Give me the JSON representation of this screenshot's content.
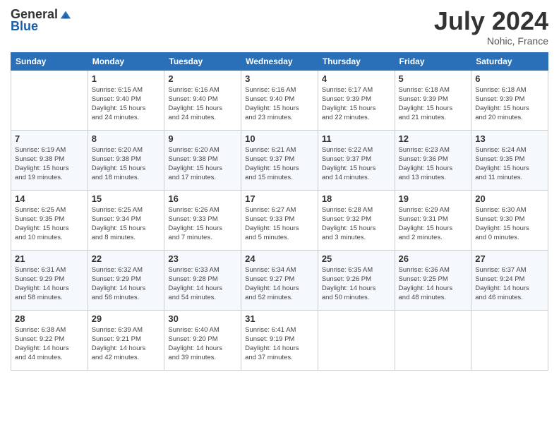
{
  "header": {
    "logo_general": "General",
    "logo_blue": "Blue",
    "month_title": "July 2024",
    "location": "Nohic, France"
  },
  "days_of_week": [
    "Sunday",
    "Monday",
    "Tuesday",
    "Wednesday",
    "Thursday",
    "Friday",
    "Saturday"
  ],
  "weeks": [
    [
      {
        "day": "",
        "info": ""
      },
      {
        "day": "1",
        "info": "Sunrise: 6:15 AM\nSunset: 9:40 PM\nDaylight: 15 hours\nand 24 minutes."
      },
      {
        "day": "2",
        "info": "Sunrise: 6:16 AM\nSunset: 9:40 PM\nDaylight: 15 hours\nand 24 minutes."
      },
      {
        "day": "3",
        "info": "Sunrise: 6:16 AM\nSunset: 9:40 PM\nDaylight: 15 hours\nand 23 minutes."
      },
      {
        "day": "4",
        "info": "Sunrise: 6:17 AM\nSunset: 9:39 PM\nDaylight: 15 hours\nand 22 minutes."
      },
      {
        "day": "5",
        "info": "Sunrise: 6:18 AM\nSunset: 9:39 PM\nDaylight: 15 hours\nand 21 minutes."
      },
      {
        "day": "6",
        "info": "Sunrise: 6:18 AM\nSunset: 9:39 PM\nDaylight: 15 hours\nand 20 minutes."
      }
    ],
    [
      {
        "day": "7",
        "info": "Sunrise: 6:19 AM\nSunset: 9:38 PM\nDaylight: 15 hours\nand 19 minutes."
      },
      {
        "day": "8",
        "info": "Sunrise: 6:20 AM\nSunset: 9:38 PM\nDaylight: 15 hours\nand 18 minutes."
      },
      {
        "day": "9",
        "info": "Sunrise: 6:20 AM\nSunset: 9:38 PM\nDaylight: 15 hours\nand 17 minutes."
      },
      {
        "day": "10",
        "info": "Sunrise: 6:21 AM\nSunset: 9:37 PM\nDaylight: 15 hours\nand 15 minutes."
      },
      {
        "day": "11",
        "info": "Sunrise: 6:22 AM\nSunset: 9:37 PM\nDaylight: 15 hours\nand 14 minutes."
      },
      {
        "day": "12",
        "info": "Sunrise: 6:23 AM\nSunset: 9:36 PM\nDaylight: 15 hours\nand 13 minutes."
      },
      {
        "day": "13",
        "info": "Sunrise: 6:24 AM\nSunset: 9:35 PM\nDaylight: 15 hours\nand 11 minutes."
      }
    ],
    [
      {
        "day": "14",
        "info": "Sunrise: 6:25 AM\nSunset: 9:35 PM\nDaylight: 15 hours\nand 10 minutes."
      },
      {
        "day": "15",
        "info": "Sunrise: 6:25 AM\nSunset: 9:34 PM\nDaylight: 15 hours\nand 8 minutes."
      },
      {
        "day": "16",
        "info": "Sunrise: 6:26 AM\nSunset: 9:33 PM\nDaylight: 15 hours\nand 7 minutes."
      },
      {
        "day": "17",
        "info": "Sunrise: 6:27 AM\nSunset: 9:33 PM\nDaylight: 15 hours\nand 5 minutes."
      },
      {
        "day": "18",
        "info": "Sunrise: 6:28 AM\nSunset: 9:32 PM\nDaylight: 15 hours\nand 3 minutes."
      },
      {
        "day": "19",
        "info": "Sunrise: 6:29 AM\nSunset: 9:31 PM\nDaylight: 15 hours\nand 2 minutes."
      },
      {
        "day": "20",
        "info": "Sunrise: 6:30 AM\nSunset: 9:30 PM\nDaylight: 15 hours\nand 0 minutes."
      }
    ],
    [
      {
        "day": "21",
        "info": "Sunrise: 6:31 AM\nSunset: 9:29 PM\nDaylight: 14 hours\nand 58 minutes."
      },
      {
        "day": "22",
        "info": "Sunrise: 6:32 AM\nSunset: 9:29 PM\nDaylight: 14 hours\nand 56 minutes."
      },
      {
        "day": "23",
        "info": "Sunrise: 6:33 AM\nSunset: 9:28 PM\nDaylight: 14 hours\nand 54 minutes."
      },
      {
        "day": "24",
        "info": "Sunrise: 6:34 AM\nSunset: 9:27 PM\nDaylight: 14 hours\nand 52 minutes."
      },
      {
        "day": "25",
        "info": "Sunrise: 6:35 AM\nSunset: 9:26 PM\nDaylight: 14 hours\nand 50 minutes."
      },
      {
        "day": "26",
        "info": "Sunrise: 6:36 AM\nSunset: 9:25 PM\nDaylight: 14 hours\nand 48 minutes."
      },
      {
        "day": "27",
        "info": "Sunrise: 6:37 AM\nSunset: 9:24 PM\nDaylight: 14 hours\nand 46 minutes."
      }
    ],
    [
      {
        "day": "28",
        "info": "Sunrise: 6:38 AM\nSunset: 9:22 PM\nDaylight: 14 hours\nand 44 minutes."
      },
      {
        "day": "29",
        "info": "Sunrise: 6:39 AM\nSunset: 9:21 PM\nDaylight: 14 hours\nand 42 minutes."
      },
      {
        "day": "30",
        "info": "Sunrise: 6:40 AM\nSunset: 9:20 PM\nDaylight: 14 hours\nand 39 minutes."
      },
      {
        "day": "31",
        "info": "Sunrise: 6:41 AM\nSunset: 9:19 PM\nDaylight: 14 hours\nand 37 minutes."
      },
      {
        "day": "",
        "info": ""
      },
      {
        "day": "",
        "info": ""
      },
      {
        "day": "",
        "info": ""
      }
    ]
  ]
}
